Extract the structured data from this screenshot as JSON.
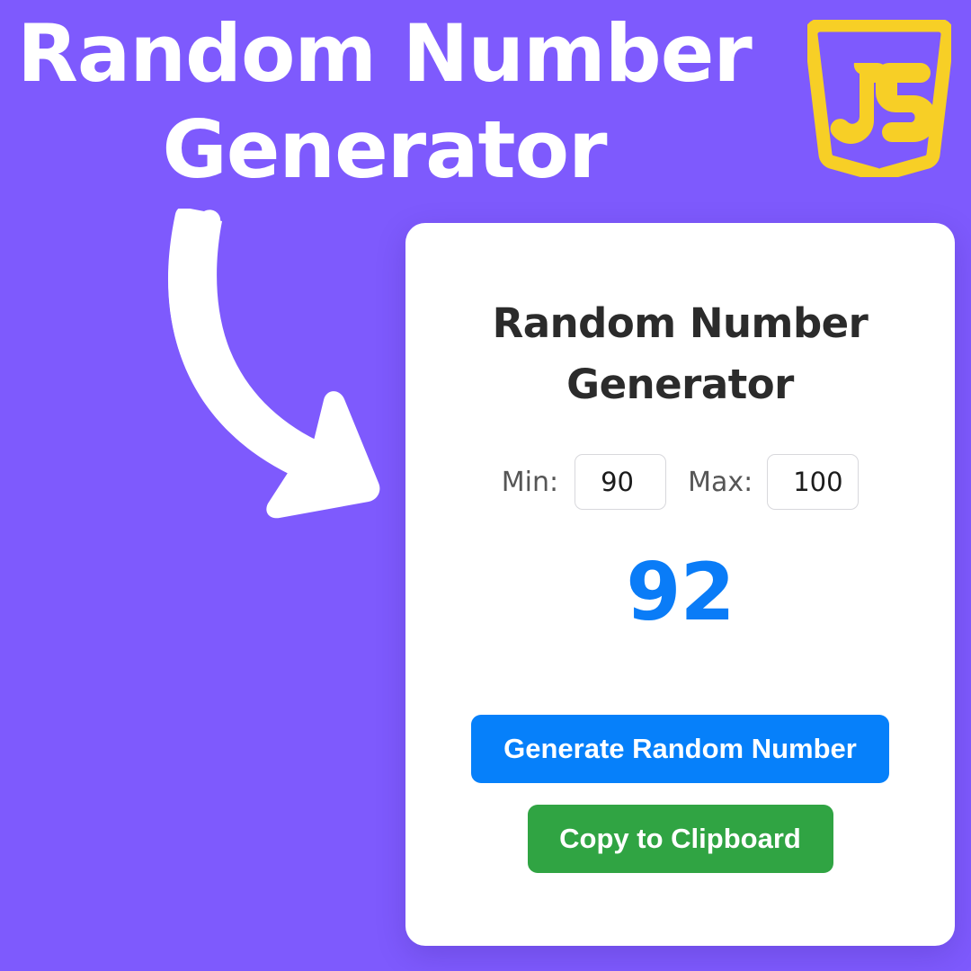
{
  "theme": {
    "background_color": "#7e5afd",
    "card_background": "#ffffff",
    "accent_blue": "#0680fa",
    "accent_green": "#30a443",
    "result_color": "#0a7cf7",
    "logo_color": "#f7cf26",
    "arrow_color": "#ffffff"
  },
  "promo": {
    "title_line1": "Random Number",
    "title_line2": "Generator",
    "logo_text": "JS",
    "logo_name": "javascript-logo"
  },
  "card": {
    "title_line1": "Random Number",
    "title_line2": "Generator",
    "min_label": "Min:",
    "min_value": "90",
    "min_placeholder": "Min",
    "max_label": "Max:",
    "max_value": "100",
    "max_placeholder": "Max",
    "result_value": "92",
    "generate_label": "Generate Random Number",
    "copy_label": "Copy to Clipboard"
  }
}
